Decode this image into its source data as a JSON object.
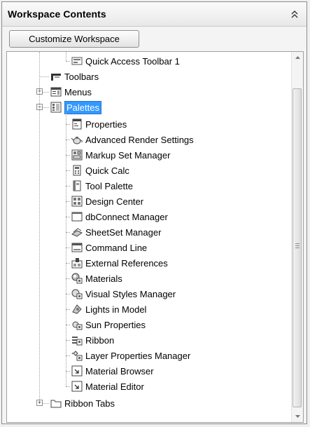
{
  "panel": {
    "title": "Workspace Contents",
    "customize_label": "Customize Workspace"
  },
  "tree": {
    "quick_access": "Quick Access Toolbar 1",
    "toolbars": "Toolbars",
    "menus": "Menus",
    "palettes": "Palettes",
    "palette_items": [
      {
        "label": "Properties",
        "icon": "properties-icon"
      },
      {
        "label": "Advanced Render Settings",
        "icon": "teapot-icon"
      },
      {
        "label": "Markup Set Manager",
        "icon": "markup-icon"
      },
      {
        "label": "Quick Calc",
        "icon": "calculator-icon"
      },
      {
        "label": "Tool Palette",
        "icon": "tool-palette-icon"
      },
      {
        "label": "Design Center",
        "icon": "design-center-icon"
      },
      {
        "label": "dbConnect Manager",
        "icon": "window-icon"
      },
      {
        "label": "SheetSet Manager",
        "icon": "sheetset-icon"
      },
      {
        "label": "Command Line",
        "icon": "command-line-icon"
      },
      {
        "label": "External References",
        "icon": "external-references-icon"
      },
      {
        "label": "Materials",
        "icon": "materials-icon"
      },
      {
        "label": "Visual Styles Manager",
        "icon": "visual-styles-icon"
      },
      {
        "label": "Lights in Model",
        "icon": "lights-icon"
      },
      {
        "label": "Sun Properties",
        "icon": "sun-icon"
      },
      {
        "label": "Ribbon",
        "icon": "ribbon-icon"
      },
      {
        "label": "Layer Properties Manager",
        "icon": "layer-icon"
      },
      {
        "label": "Material Browser",
        "icon": "material-browser-icon"
      },
      {
        "label": "Material Editor",
        "icon": "material-editor-icon"
      }
    ],
    "ribbon_tabs": "Ribbon Tabs"
  },
  "colors": {
    "selection": "#3399ff",
    "tree_line": "#a0a0a0"
  }
}
